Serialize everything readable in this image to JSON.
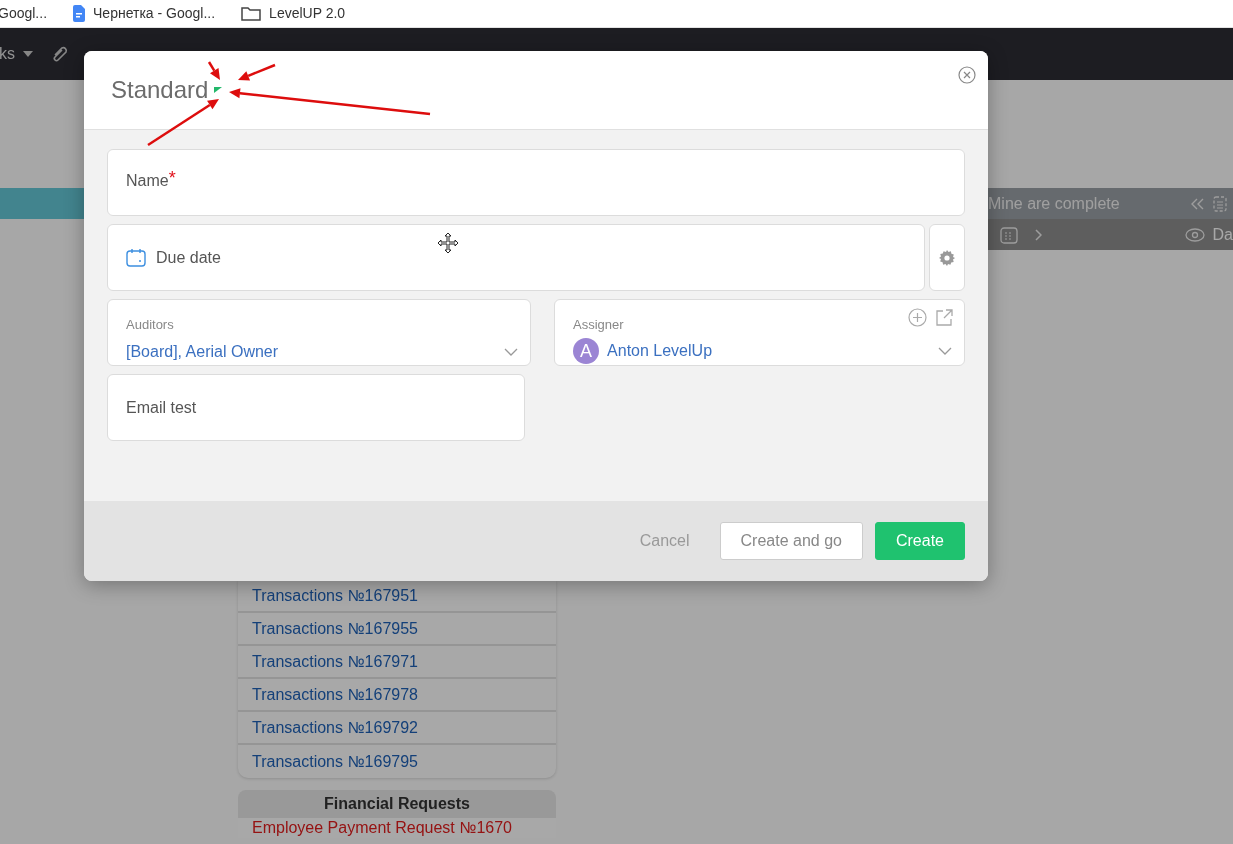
{
  "bookmarks": [
    {
      "label": "Googl...",
      "kind": "page"
    },
    {
      "label": "Чернетка - Googl...",
      "kind": "doc"
    },
    {
      "label": "LevelUP 2.0",
      "kind": "folder"
    }
  ],
  "navbar": {
    "menu_label": "ks"
  },
  "right_panel": {
    "title": "Mine are complete",
    "column_label": "Da"
  },
  "transactions": [
    "Transactions №167951",
    "Transactions №167955",
    "Transactions №167971",
    "Transactions №167978",
    "Transactions №169792",
    "Transactions №169795"
  ],
  "financial_requests": {
    "title": "Financial Requests",
    "items": [
      "Employee Payment Request №1670"
    ]
  },
  "modal": {
    "title": "Standard",
    "required_mark": "*",
    "fields": [
      {
        "kind": "text",
        "placeholder": "Name",
        "required": true
      },
      {
        "kind": "date",
        "placeholder": "Due date",
        "required": false
      },
      {
        "kind": "select",
        "label": "Auditors",
        "value": "[Board], Aerial Owner"
      },
      {
        "kind": "user",
        "label": "Assigner",
        "value": "Anton LevelUp",
        "avatar_letter": "A"
      },
      {
        "kind": "text",
        "placeholder": "Email test",
        "required": false
      }
    ],
    "buttons": [
      {
        "label": "Cancel",
        "kind": "link"
      },
      {
        "label": "Create and go",
        "kind": "outline"
      },
      {
        "label": "Create",
        "kind": "primary"
      }
    ]
  }
}
